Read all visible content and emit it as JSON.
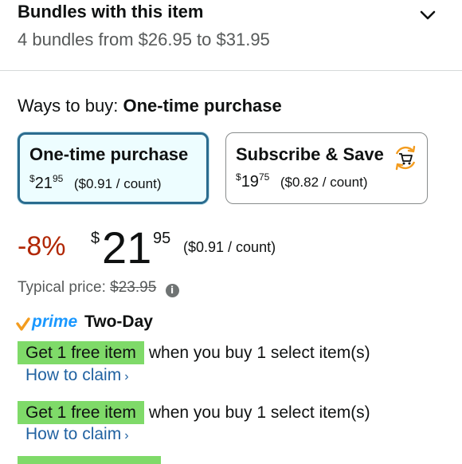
{
  "bundles": {
    "title": "Bundles with this item",
    "subtitle": "4 bundles from $26.95 to $31.95",
    "toggle_icon": "chevron-down-icon"
  },
  "ways_to_buy": {
    "label": "Ways to buy:",
    "selected": "One-time purchase"
  },
  "options": [
    {
      "title": "One-time purchase",
      "currency": "$",
      "whole": "21",
      "fraction": "95",
      "unit_price": "($0.91 / count)",
      "selected": true
    },
    {
      "title": "Subscribe & Save",
      "currency": "$",
      "whole": "19",
      "fraction": "75",
      "unit_price": "($0.82 / count)",
      "selected": false,
      "icon": "subscribe-cart-icon"
    }
  ],
  "price": {
    "discount": "-8%",
    "currency": "$",
    "whole": "21",
    "fraction": "95",
    "unit_price": "($0.91 / count)"
  },
  "typical": {
    "label": "Typical price:",
    "value": "$23.95",
    "icon": "info-icon"
  },
  "prime": {
    "logo": "prime",
    "delivery": "Two-Day"
  },
  "promotions": [
    {
      "badge": "Get 1 free item",
      "text": "when you buy 1 select item(s)",
      "link": "How to claim"
    },
    {
      "badge": "Get 1 free item",
      "text": "when you buy 1 select item(s)",
      "link": "How to claim"
    }
  ],
  "colors": {
    "discount": "#b12704",
    "link": "#2162a1",
    "badge": "#7fda69",
    "prime": "#1a98ff",
    "selected_border": "#2b6c8f"
  }
}
